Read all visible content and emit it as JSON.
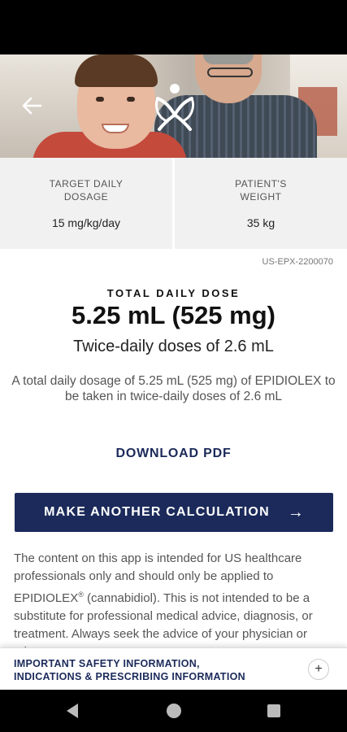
{
  "header": {
    "back_icon": "arrow-left-icon",
    "logo_icon": "epidiolex-logo-icon"
  },
  "inputs_summary": {
    "target": {
      "label_line1": "TARGET DAILY",
      "label_line2": "DOSAGE",
      "value": "15 mg/kg/day"
    },
    "weight": {
      "label_line1": "PATIENT'S",
      "label_line2": "WEIGHT",
      "value": "35 kg"
    }
  },
  "result": {
    "code": "US-EPX-2200070",
    "total_label": "TOTAL DAILY DOSE",
    "total_value": "5.25 mL (525 mg)",
    "twice_daily": "Twice-daily doses of 2.6 mL",
    "description": "A total daily dosage of 5.25 mL (525 mg) of EPIDIOLEX to be taken in twice-daily doses of 2.6 mL"
  },
  "actions": {
    "download_label": "DOWNLOAD PDF",
    "cta_label": "MAKE ANOTHER CALCULATION",
    "cta_arrow": "→"
  },
  "disclaimer": {
    "part1": "The content on this app is intended for US healthcare professionals only and should only be applied to EPIDIOLEX",
    "reg": "®",
    "part2": " (cannabidiol). This is not intended to be a substitute for professional medical advice, diagnosis, or treatment. Always seek the advice of your physician or other"
  },
  "isi_bar": {
    "line1": "IMPORTANT SAFETY INFORMATION,",
    "line2": "INDICATIONS & PRESCRIBING INFORMATION",
    "expand": "+"
  },
  "colors": {
    "brand_navy": "#1b2a5a",
    "card_bg": "#f1f1f1"
  }
}
